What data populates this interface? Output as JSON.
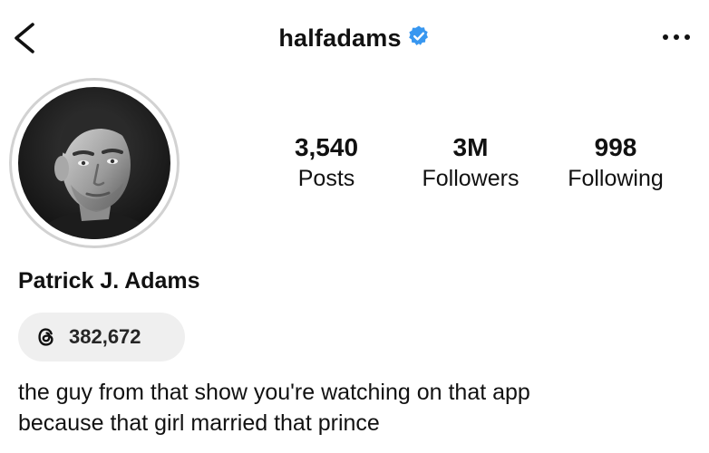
{
  "header": {
    "username": "halfadams",
    "verified": true,
    "verified_color": "#3897f0"
  },
  "profile": {
    "display_name": "Patrick J. Adams",
    "avatar": "profile-photo"
  },
  "stats": {
    "posts": {
      "value": "3,540",
      "label": "Posts"
    },
    "followers": {
      "value": "3M",
      "label": "Followers"
    },
    "following": {
      "value": "998",
      "label": "Following"
    }
  },
  "threads": {
    "icon": "threads-icon",
    "count": "382,672"
  },
  "bio": {
    "lines": [
      "the guy from that show you're watching on that app",
      "because that girl married that prince"
    ]
  }
}
